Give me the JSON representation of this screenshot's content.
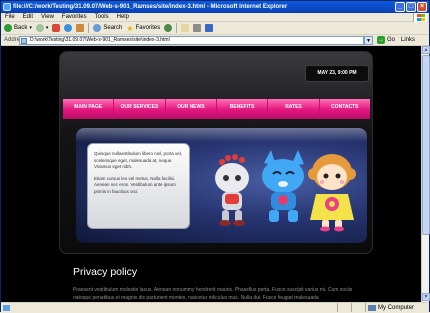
{
  "window": {
    "title": "file://Fyhv..........................Mlcrosoft Internet Explorer",
    "title_display": "file:///C:/work/Testing/31.09.07/Web-s-901_Ramses/site/index-3.html - Microsoft Internet Explorer"
  },
  "menu": [
    "File",
    "Edit",
    "View",
    "Favorites",
    "Tools",
    "Help"
  ],
  "toolbar": {
    "back": "Back",
    "search": "Search",
    "favorites": "Favorites"
  },
  "address": {
    "label": "Address",
    "value": "D:\\work\\Testing\\31.09.07\\Web-s-901_Ramses\\site\\index-3.html",
    "go": "Go",
    "links": "Links"
  },
  "site": {
    "date": "MAY 23, 9:00 PM",
    "nav": [
      "MAIN PAGE",
      "OUR SERVICES",
      "OUR NEWS",
      "BENEFITS",
      "RATES",
      "CONTACTS"
    ],
    "bubble": {
      "para1": "Quisque nullaestibulum libero nisl, porta vel, scelerisque eget, malesuada at, neque. Vivamus eget nibh.",
      "para2": "Etiam cursus leo vel metus. Nulla facilisi. Aenean nec eros. Vestibulum ante ipsum primis in faucibus orci."
    },
    "page_title": "Privacy policy",
    "body_text": "Praesent vestibulum molestie lacus. Aenean nonummy hendrerit mauris. Phasellus porta. Fusce suscipit varius mi. Cum sociis natoque penatibus et magnis dis parturient montes, nascetur ridiculus mus. Nulla dui. Fusce feugiat malesuada"
  },
  "status": {
    "left": "",
    "zone": "My Computer"
  },
  "colors": {
    "nav_pink": "#e2167e",
    "frame_black": "#141416",
    "xp_blue": "#0a5be0"
  }
}
